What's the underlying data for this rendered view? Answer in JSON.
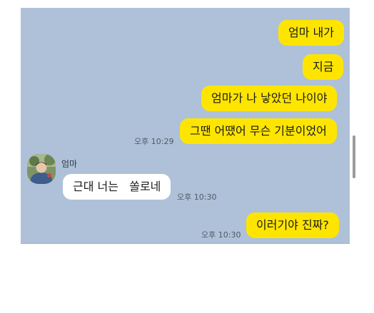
{
  "conversation": {
    "sender_name": "엄마",
    "messages": [
      {
        "from": "me",
        "text": "엄마 내가"
      },
      {
        "from": "me",
        "text": "지금"
      },
      {
        "from": "me",
        "text": "엄마가 나 낳았던 나이야"
      },
      {
        "from": "me",
        "text": "그땐 어땠어 무슨 기분이었어",
        "time": "오후 10:29"
      },
      {
        "from": "mom",
        "text": "근대 너는   쏠로네",
        "time": "오후 10:30"
      },
      {
        "from": "me",
        "text": "이러기야 진짜?",
        "time": "오후 10:30"
      }
    ]
  },
  "colors": {
    "chat_background": "#aec1d8",
    "sent_bubble": "#fee500",
    "received_bubble": "#ffffff"
  },
  "icons": {
    "avatar": "profile-photo-avatar"
  }
}
